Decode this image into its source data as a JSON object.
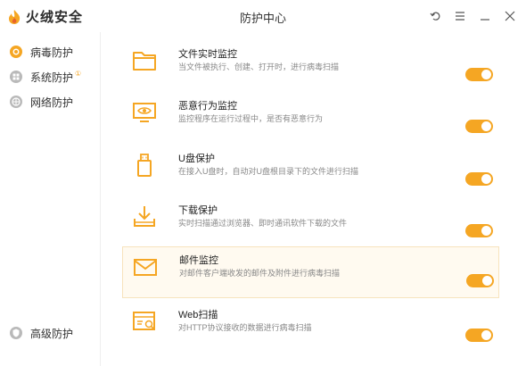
{
  "app": {
    "logo_text": "火绒安全",
    "window_title": "防护中心"
  },
  "colors": {
    "accent": "#f5a623",
    "highlight_bg": "#fffaf0"
  },
  "window_controls": [
    {
      "icon": "back-icon"
    },
    {
      "icon": "menu-icon"
    },
    {
      "icon": "minimize-icon"
    },
    {
      "icon": "close-icon"
    }
  ],
  "sidebar": {
    "items": [
      {
        "label": "病毒防护",
        "icon": "virus-protection-icon",
        "active": true
      },
      {
        "label": "系统防护",
        "icon": "system-protection-icon",
        "badge": "①"
      },
      {
        "label": "网络防护",
        "icon": "network-protection-icon"
      }
    ],
    "bottom": {
      "label": "高级防护",
      "icon": "advanced-protection-icon"
    }
  },
  "features": [
    {
      "title": "文件实时监控",
      "desc": "当文件被执行、创建、打开时，进行病毒扫描",
      "icon": "folder-icon",
      "enabled": true
    },
    {
      "title": "恶意行为监控",
      "desc": "监控程序在运行过程中，是否有恶意行为",
      "icon": "monitor-eye-icon",
      "enabled": true
    },
    {
      "title": "U盘保护",
      "desc": "在接入U盘时，自动对U盘根目录下的文件进行扫描",
      "icon": "usb-drive-icon",
      "enabled": true
    },
    {
      "title": "下载保护",
      "desc": "实时扫描通过浏览器、即时通讯软件下载的文件",
      "icon": "download-icon",
      "enabled": true
    },
    {
      "title": "邮件监控",
      "desc": "对邮件客户端收发的邮件及附件进行病毒扫描",
      "icon": "mail-icon",
      "enabled": true,
      "highlighted": true
    },
    {
      "title": "Web扫描",
      "desc": "对HTTP协议接收的数据进行病毒扫描",
      "icon": "web-scan-icon",
      "enabled": true
    }
  ]
}
